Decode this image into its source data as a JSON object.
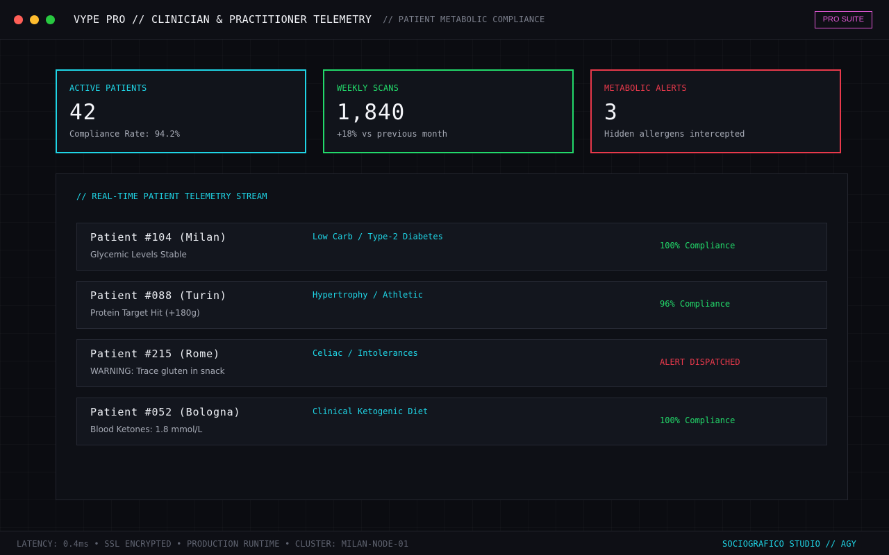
{
  "window": {
    "title": "VYPE PRO // CLINICIAN & PRACTITIONER TELEMETRY",
    "subtitle": "// PATIENT METABOLIC COMPLIANCE",
    "badge": "PRO SUITE"
  },
  "colors": {
    "cyan": "#1fd5e6",
    "green": "#22d96a",
    "red": "#e8394b",
    "magenta": "#e35ad8",
    "background": "#0b0c11"
  },
  "stats": [
    {
      "label": "ACTIVE PATIENTS",
      "value": "42",
      "desc": "Compliance Rate: 94.2%"
    },
    {
      "label": "WEEKLY SCANS",
      "value": "1,840",
      "desc": "+18% vs previous month"
    },
    {
      "label": "METABOLIC ALERTS",
      "value": "3",
      "desc": "Hidden allergens intercepted"
    }
  ],
  "stream": {
    "title": "// REAL-TIME PATIENT TELEMETRY STREAM",
    "rows": [
      {
        "name": "Patient #104 (Milan)",
        "note": "Glycemic Levels Stable",
        "diet": "Low Carb / Type-2 Diabetes",
        "status": "100% Compliance",
        "status_color": "#22d96a"
      },
      {
        "name": "Patient #088 (Turin)",
        "note": "Protein Target Hit (+180g)",
        "diet": "Hypertrophy / Athletic",
        "status": "96% Compliance",
        "status_color": "#22d96a"
      },
      {
        "name": "Patient #215 (Rome)",
        "note": "WARNING: Trace gluten in snack",
        "diet": "Celiac / Intolerances",
        "status": "ALERT DISPATCHED",
        "status_color": "#e8394b"
      },
      {
        "name": "Patient #052 (Bologna)",
        "note": "Blood Ketones: 1.8 mmol/L",
        "diet": "Clinical Ketogenic Diet",
        "status": "100% Compliance",
        "status_color": "#22d96a"
      }
    ]
  },
  "footer": {
    "left": "LATENCY: 0.4ms • SSL ENCRYPTED • PRODUCTION RUNTIME • CLUSTER: MILAN-NODE-01",
    "right": "SOCIOGRAFICO STUDIO // AGY"
  }
}
